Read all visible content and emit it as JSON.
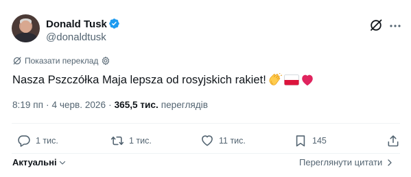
{
  "author": {
    "display_name": "Donald Tusk",
    "handle": "@donaldtusk",
    "verified": true
  },
  "translate": {
    "label": "Показати переклад"
  },
  "tweet": {
    "text": "Nasza Pszczółka Maja lepsza od rosyjskich rakiet!",
    "emojis": [
      "clapping-hands",
      "flag-poland",
      "red-heart"
    ]
  },
  "meta": {
    "time": "8:19 пп",
    "date": "4 черв. 2026",
    "separator": "·",
    "views_count": "365,5 тис.",
    "views_label": "переглядів"
  },
  "actions": {
    "replies": "1 тис.",
    "reposts": "1 тис.",
    "likes": "11 тис.",
    "bookmarks": "145"
  },
  "footer": {
    "sort_label": "Актуальні",
    "quotes_label": "Переглянути цитати"
  },
  "colors": {
    "verified_blue": "#1d9bf0",
    "secondary_text": "#536471",
    "primary_text": "#0f1419",
    "heart_red": "#e0245e",
    "flag_red": "#dc143c"
  }
}
